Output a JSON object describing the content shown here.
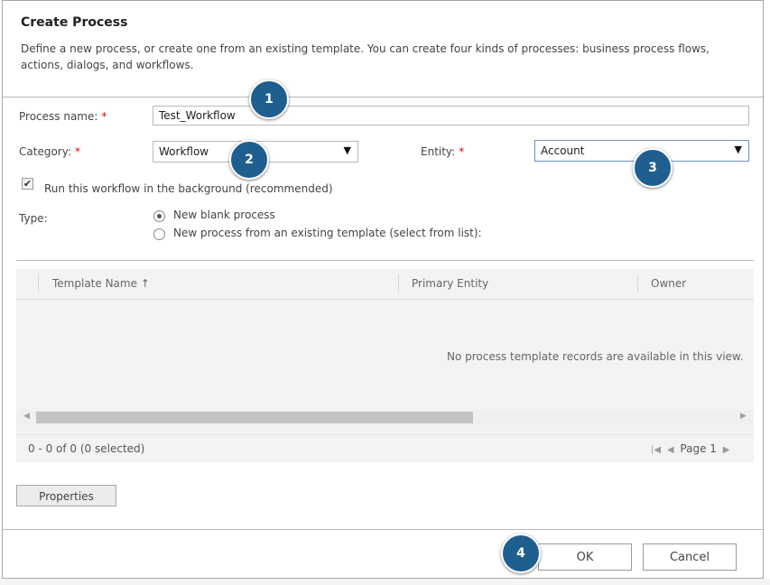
{
  "dialog": {
    "title": "Create Process",
    "description": "Define a new process, or create one from an existing template. You can create four kinds of processes: business process flows, actions, dialogs, and workflows."
  },
  "form": {
    "process_name_label": "Process name:",
    "process_name_value": "Test_Workflow",
    "category_label": "Category:",
    "category_value": "Workflow",
    "entity_label": "Entity:",
    "entity_value": "Account",
    "required_mark": "*",
    "background_checkbox_label": "Run this workflow in the background (recommended)",
    "background_checked": true,
    "type_label": "Type:",
    "type_options": [
      {
        "label": "New blank process",
        "selected": true
      },
      {
        "label": "New process from an existing template (select from list):",
        "selected": false
      }
    ]
  },
  "grid": {
    "columns": [
      "Template Name ↑",
      "Primary Entity",
      "Owner"
    ],
    "empty_message": "No process template records are available in this view.",
    "record_count": "0 - 0 of 0 (0 selected)",
    "page_label": "Page 1"
  },
  "buttons": {
    "properties": "Properties",
    "ok": "OK",
    "cancel": "Cancel"
  },
  "callouts": [
    "1",
    "2",
    "3",
    "4"
  ],
  "colors": {
    "callout": "#1f5f8f",
    "required": "#e00000",
    "grid_bg": "#f3f3f3"
  },
  "icons": {
    "dropdown": "triangle-down",
    "sort": "arrow-up",
    "checkbox": "checkmark",
    "pager_first": "first-page",
    "pager_prev": "prev-page",
    "pager_next": "next-page"
  }
}
